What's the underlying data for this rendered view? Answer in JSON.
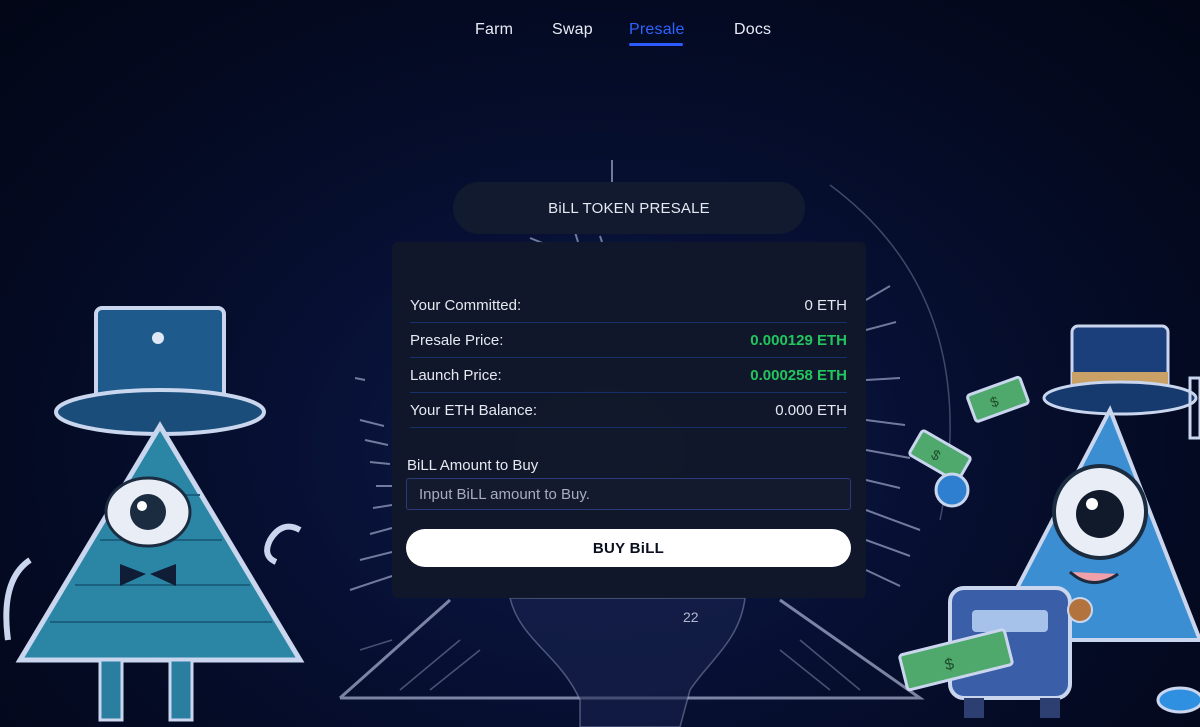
{
  "nav": {
    "items": [
      {
        "label": "Farm",
        "active": false
      },
      {
        "label": "Swap",
        "active": false
      },
      {
        "label": "Presale",
        "active": true
      },
      {
        "label": "Docs",
        "active": false
      }
    ]
  },
  "presale": {
    "title": "BiLL TOKEN PRESALE",
    "rows": [
      {
        "label": "Your Committed:",
        "value": "0 ETH",
        "highlight": false
      },
      {
        "label": "Presale Price:",
        "value": "0.000129 ETH",
        "highlight": true
      },
      {
        "label": "Launch Price:",
        "value": "0.000258 ETH",
        "highlight": true
      },
      {
        "label": "Your ETH Balance:",
        "value": "0.000 ETH",
        "highlight": false
      }
    ],
    "amount_label": "BiLL Amount to Buy",
    "amount_value": "",
    "amount_placeholder": "Input BiLL amount to Buy.",
    "buy_button": "BUY BiLL"
  },
  "background": {
    "clock_number": "22"
  },
  "colors": {
    "accent": "#2d63ff",
    "price_green": "#22c55e",
    "card_bg": "#12182a"
  }
}
